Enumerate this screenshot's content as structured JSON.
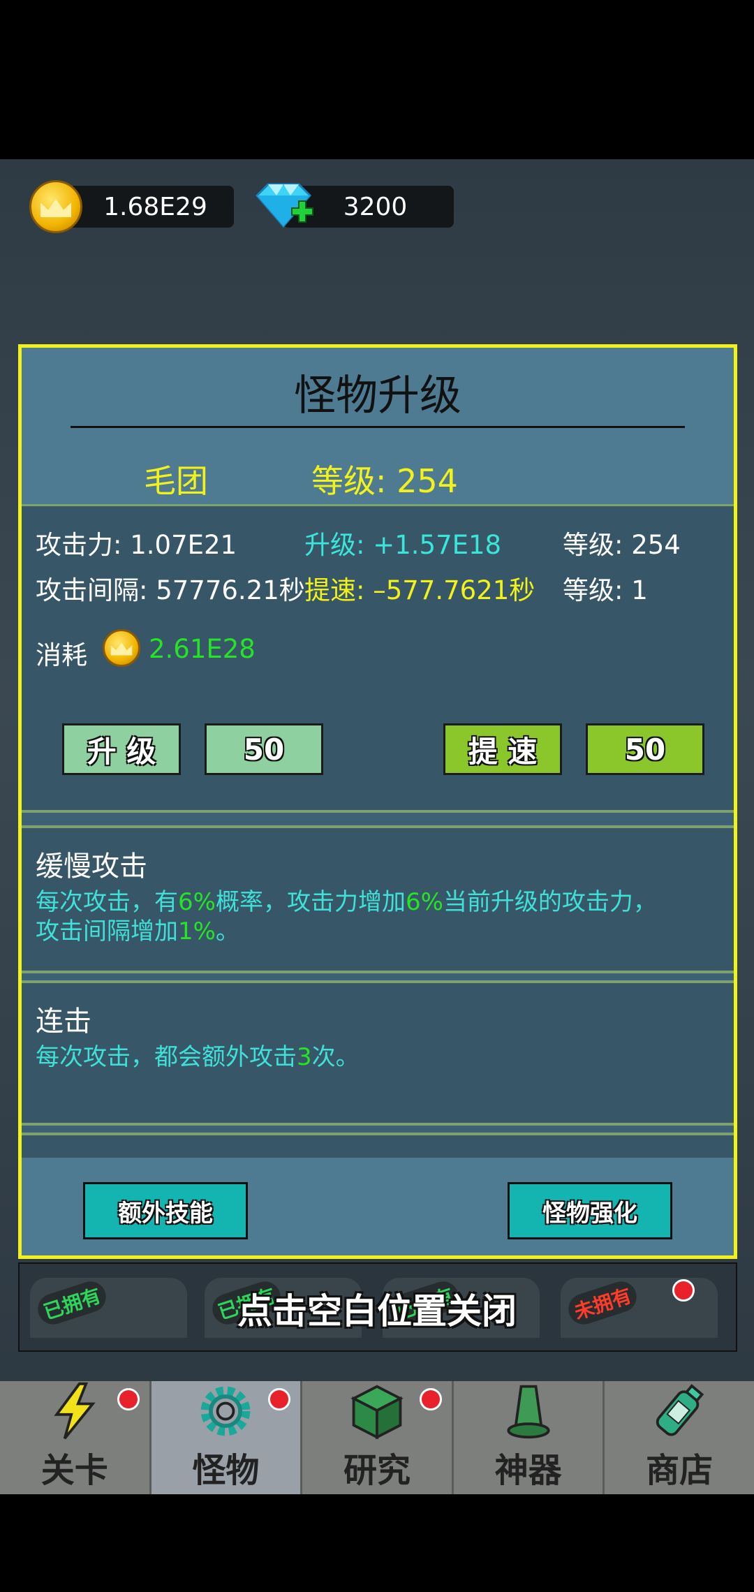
{
  "currency": {
    "gold": "1.68E29",
    "diamonds": "3200"
  },
  "modal": {
    "title": "怪物升级",
    "monster_name": "毛团",
    "level_label": "等级: 254",
    "stats": {
      "attack": "攻击力: 1.07E21",
      "upgrade_gain": "升级: +1.57E18",
      "attack_level": "等级: 254",
      "interval": "攻击间隔: 57776.21秒",
      "speed_gain": "提速: –577.7621秒",
      "speed_level": "等级: 1",
      "cost_label": "消耗",
      "cost_value": "2.61E28"
    },
    "buttons": {
      "upgrade": "升 级",
      "upgrade_qty": "50",
      "speedup": "提 速",
      "speedup_qty": "50"
    },
    "skills": [
      {
        "title": "缓慢攻击",
        "desc_1": "每次攻击，有",
        "pct_1": "6%",
        "desc_2": "概率，攻击力增加",
        "pct_2": "6%",
        "desc_3": "当前升级的攻击力，",
        "desc_4": "攻击间隔增加",
        "pct_3": "1%",
        "desc_5": "。"
      },
      {
        "title": "连击",
        "desc_1": "每次攻击，都会额外攻击",
        "num": "3",
        "desc_2": "次。"
      }
    ],
    "footer": {
      "extra_skills": "额外技能",
      "monster_boost": "怪物强化"
    }
  },
  "strip": {
    "owned_1": "已拥有",
    "owned_2": "已拥有",
    "owned_3": "已拥有",
    "not_owned": "未拥有"
  },
  "hint": "点击空白位置关闭",
  "nav": [
    {
      "label": "关卡",
      "icon": "lightning-icon"
    },
    {
      "label": "怪物",
      "icon": "gear-icon"
    },
    {
      "label": "研究",
      "icon": "cube-icon"
    },
    {
      "label": "神器",
      "icon": "artifact-icon"
    },
    {
      "label": "商店",
      "icon": "potion-icon"
    }
  ],
  "colors": {
    "accent": "#f2f21a",
    "panel": "#4e7a92",
    "cyan": "#39e6d9",
    "green": "#27e327"
  }
}
